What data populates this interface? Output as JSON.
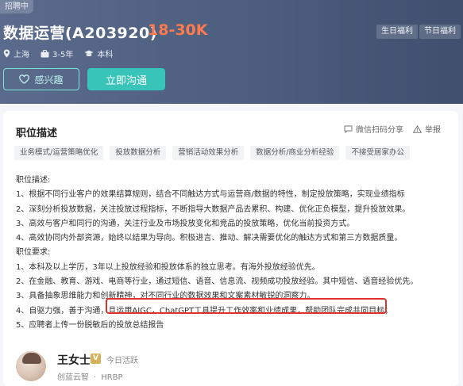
{
  "header": {
    "status": "招聘中",
    "title": "数据运营(A203920)",
    "salary": "18-30K",
    "benefits": [
      "生日福利",
      "节日福利"
    ],
    "location": "上海",
    "experience": "3-5年",
    "education": "本科",
    "interest_label": "感兴趣",
    "chat_label": "立即沟通"
  },
  "card": {
    "section_title": "职位描述",
    "share_label": "微信扫码分享",
    "report_label": "举报",
    "tags": [
      "业务模式/运营策略优化",
      "投放数据分析",
      "营销活动效果分析",
      "数据分析/商业分析经验",
      "不接受居家办公"
    ],
    "lines": [
      "职位描述:",
      "1、根据不同行业客户的效果结算规则，结合不同触达方式与运营商/数据的特性，制定投放策略，实现业绩指标",
      "2、深刻分析投放数据，关注投放过程指标，不断指导大数据产品去累积、构建、优化正负模型，提升投放效果。",
      "3、高效与客户和同行的沟通，关注行业及市场投放变化和竞品的投放策略，优化当前投资方式。",
      "4、高效协同内外部资源，始终以结果为导向。积极进言、推动、解决需要优化的触达方式和第三方数据质量。",
      "职位要求:",
      "1、本科及以上学历，3年以上投放经验和投放体系的独立思考。有海外投放经验优先。",
      "2、在金融、教育、游戏、电商等行业，通过短信、语音、信息流、视频成功投放经验。其中短信、语音经验优先。",
      "3、具备抽象思维能力和创新精神，对不同行业的数据效果和文案素材敏锐的洞察力。",
      "4、自驱力强，善于沟通，且运用AIGC，ChatGPT工具提升工作效率和业绩成果，帮助团队完成共同目标；",
      "5、应聘者上传一份脱敏后的投放总结报告"
    ]
  },
  "recruiter": {
    "name": "王女士",
    "verified_mark": "V",
    "active_status": "今日活跃",
    "company": "创蓝云智",
    "role": "HRBP"
  },
  "colors": {
    "header_bg": "#4f6080",
    "salary": "#ff7a4d",
    "accent": "#39c4b9",
    "highlight": "#e0322c"
  }
}
